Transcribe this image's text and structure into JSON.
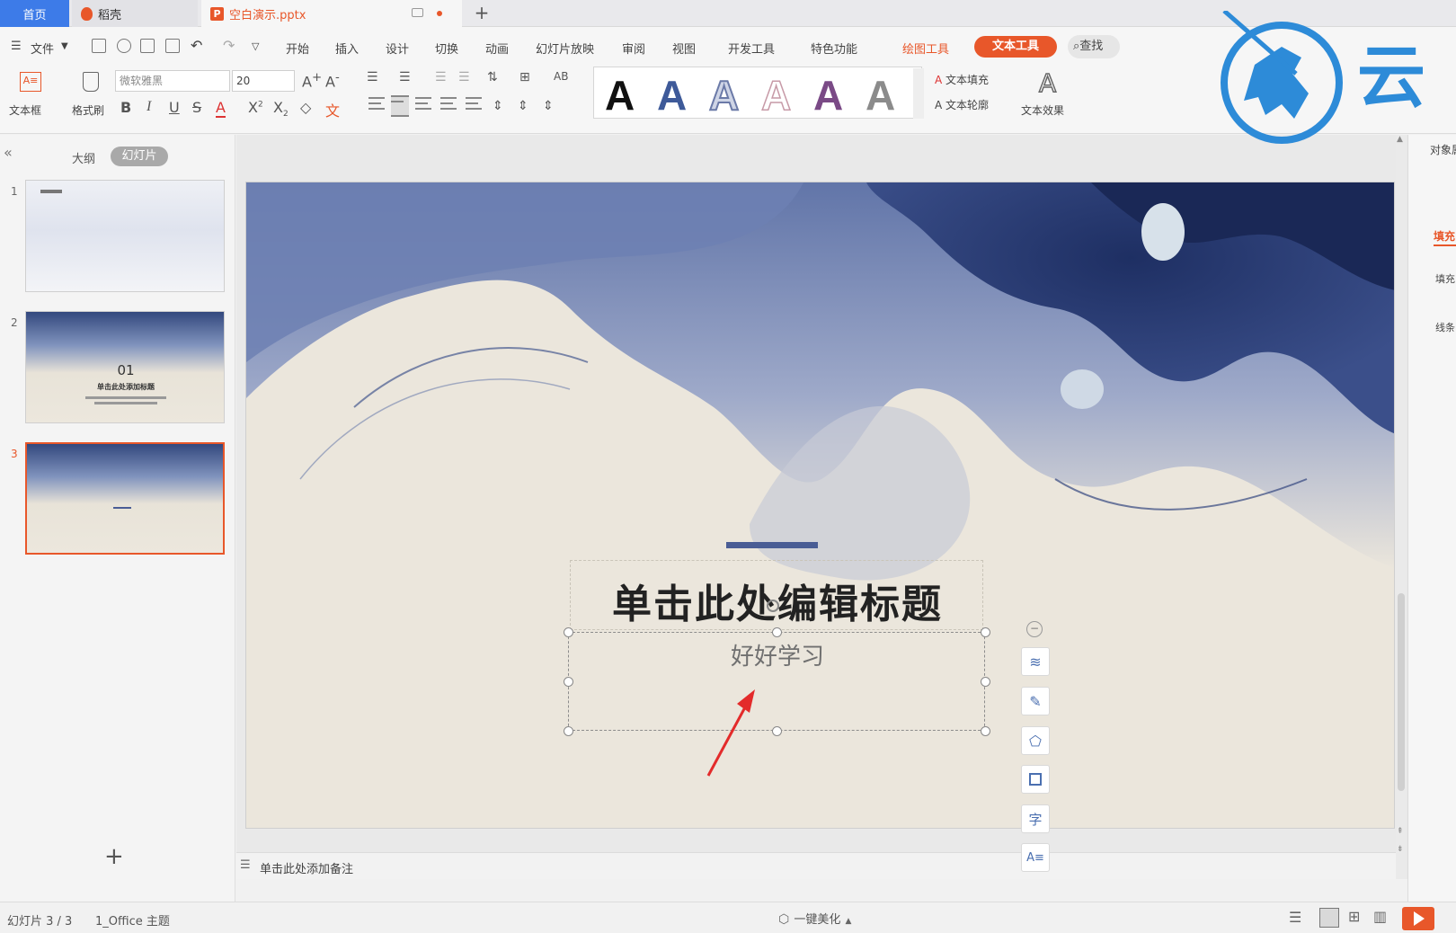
{
  "tabs": {
    "home": "首页",
    "daoke": "稻壳",
    "file": "空白演示.pptx"
  },
  "menu": {
    "file": "文件",
    "items": [
      "开始",
      "插入",
      "设计",
      "切换",
      "动画",
      "幻灯片放映",
      "审阅",
      "视图",
      "开发工具",
      "特色功能"
    ],
    "drawing_tools": "绘图工具",
    "text_tools": "文本工具",
    "search": "查找"
  },
  "toolbar": {
    "textbox": "文本框",
    "format_painter": "格式刷",
    "font_name": "微软雅黑",
    "font_size": "20",
    "text_fill": "文本填充",
    "text_outline": "文本轮廓",
    "text_effect": "文本效果",
    "style_letter": "A"
  },
  "left_panel": {
    "tab_outline": "大纲",
    "tab_slides": "幻灯片",
    "slides": [
      {
        "num": "1"
      },
      {
        "num": "2",
        "text_num": "01",
        "text_title": "单击此处添加标题"
      },
      {
        "num": "3"
      }
    ],
    "add": "+"
  },
  "slide": {
    "title": "单击此处编辑标题",
    "subtitle": "好好学习"
  },
  "notes": "单击此处添加备注",
  "right_panel": {
    "label1": "对象属",
    "label2": "填充",
    "label3": "填充",
    "label4": "线条"
  },
  "status": {
    "slide_pos": "幻灯片 3 / 3",
    "theme": "1_Office 主题",
    "beautify": "一键美化"
  },
  "watermark": {
    "text": "云"
  },
  "colors": {
    "accent": "#e8572a",
    "home_tab": "#3d7be8",
    "ink": "#2b3f78",
    "watermark": "#2d8bd8"
  }
}
